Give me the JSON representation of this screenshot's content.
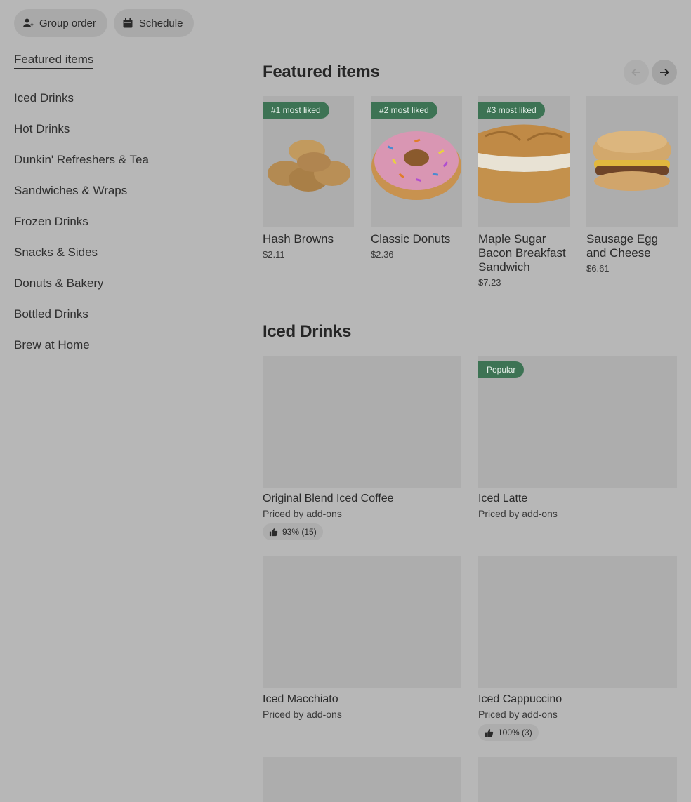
{
  "top_bar": {
    "group_order_label": "Group order",
    "schedule_label": "Schedule"
  },
  "sidebar": {
    "items": [
      {
        "label": "Featured items"
      },
      {
        "label": "Iced Drinks"
      },
      {
        "label": "Hot Drinks"
      },
      {
        "label": "Dunkin' Refreshers & Tea"
      },
      {
        "label": "Sandwiches & Wraps"
      },
      {
        "label": "Frozen Drinks"
      },
      {
        "label": "Snacks & Sides"
      },
      {
        "label": "Donuts & Bakery"
      },
      {
        "label": "Bottled Drinks"
      },
      {
        "label": "Brew at Home"
      }
    ]
  },
  "featured": {
    "title": "Featured items",
    "items": [
      {
        "badge": "#1 most liked",
        "name": "Hash Browns",
        "price": "$2.11",
        "image": "hash-browns-image"
      },
      {
        "badge": "#2 most liked",
        "name": "Classic Donuts",
        "price": "$2.36",
        "image": "donut-image"
      },
      {
        "badge": "#3 most liked",
        "name": "Maple Sugar Bacon Breakfast Sandwich",
        "price": "$7.23",
        "image": "croissant-sandwich-image"
      },
      {
        "badge": "",
        "name": "Sausage Egg and Cheese",
        "price": "$6.61",
        "image": "sausage-sandwich-image"
      }
    ]
  },
  "iced_drinks": {
    "title": "Iced Drinks",
    "items": [
      {
        "name": "Original Blend Iced Coffee",
        "sub": "Priced by add-ons",
        "rating": "93% (15)",
        "badge": ""
      },
      {
        "name": "Iced Latte",
        "sub": "Priced by add-ons",
        "rating": "",
        "badge": "Popular"
      },
      {
        "name": "Iced Macchiato",
        "sub": "Priced by add-ons",
        "rating": "",
        "badge": ""
      },
      {
        "name": "Iced Cappuccino",
        "sub": "Priced by add-ons",
        "rating": "100% (3)",
        "badge": ""
      }
    ]
  },
  "icons": {
    "group_order": "person-add-icon",
    "schedule": "calendar-icon",
    "prev": "arrow-left-icon",
    "next": "arrow-right-icon",
    "rating": "thumbs-up-icon"
  },
  "colors": {
    "badge_green": "#3d7354",
    "overlay_bg": "#b7b7b7"
  }
}
